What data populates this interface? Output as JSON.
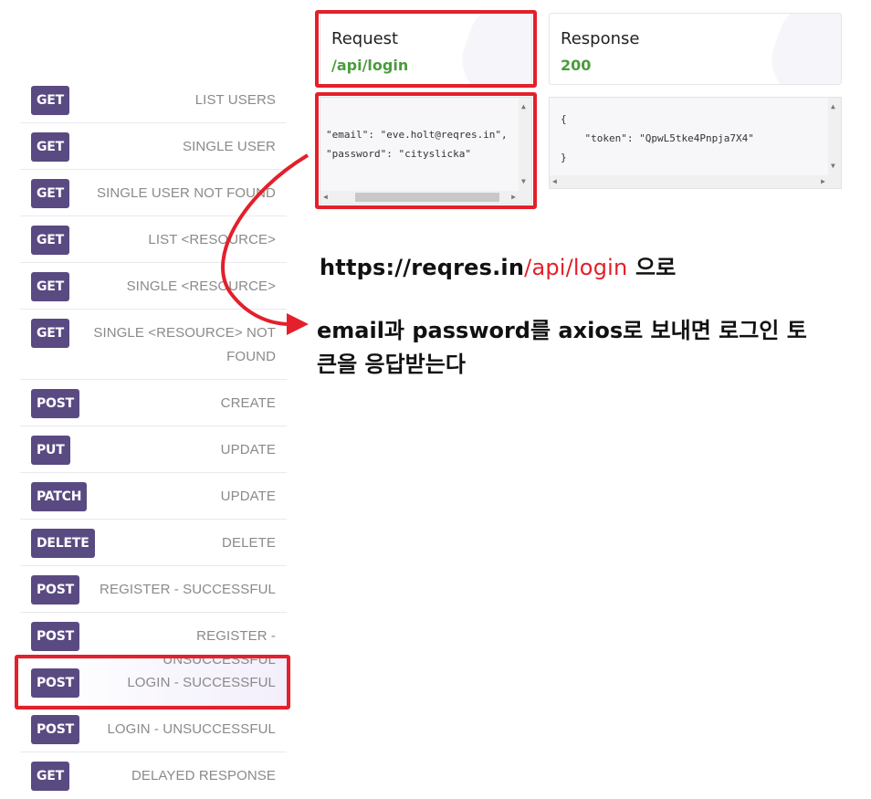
{
  "endpoints": [
    {
      "method": "GET",
      "label": "LIST USERS"
    },
    {
      "method": "GET",
      "label": "SINGLE USER"
    },
    {
      "method": "GET",
      "label": "SINGLE USER NOT FOUND"
    },
    {
      "method": "GET",
      "label": "LIST <RESOURCE>"
    },
    {
      "method": "GET",
      "label": "SINGLE <RESOURCE>"
    },
    {
      "method": "GET",
      "label": "SINGLE <RESOURCE> NOT FOUND"
    },
    {
      "method": "POST",
      "label": "CREATE"
    },
    {
      "method": "PUT",
      "label": "UPDATE"
    },
    {
      "method": "PATCH",
      "label": "UPDATE"
    },
    {
      "method": "DELETE",
      "label": "DELETE"
    },
    {
      "method": "POST",
      "label": "REGISTER - SUCCESSFUL"
    },
    {
      "method": "POST",
      "label": "REGISTER - UNSUCCESSFUL"
    },
    {
      "method": "POST",
      "label": "LOGIN - SUCCESSFUL",
      "active": true
    },
    {
      "method": "POST",
      "label": "LOGIN - UNSUCCESSFUL"
    },
    {
      "method": "GET",
      "label": "DELAYED RESPONSE"
    }
  ],
  "request": {
    "title": "Request",
    "path": "/api/login",
    "body_lines": [
      "\"email\": \"eve.holt@reqres.in\",",
      "\"password\": \"cityslicka\""
    ]
  },
  "response": {
    "title": "Response",
    "status": "200",
    "body_lines": [
      "{",
      "    \"token\": \"QpwL5tke4Pnpja7X4\"",
      "}"
    ]
  },
  "annotation": {
    "url_prefix": "https://reqres.in",
    "url_path": "/api/login",
    "url_suffix": " 으로",
    "line2": "email과 password를 axios로 보내면 로그인 토",
    "line3": "큰을 응답받는다"
  },
  "colors": {
    "highlight": "#e3202b",
    "method_badge": "#5a4a82",
    "status_green": "#4a9c3c"
  }
}
